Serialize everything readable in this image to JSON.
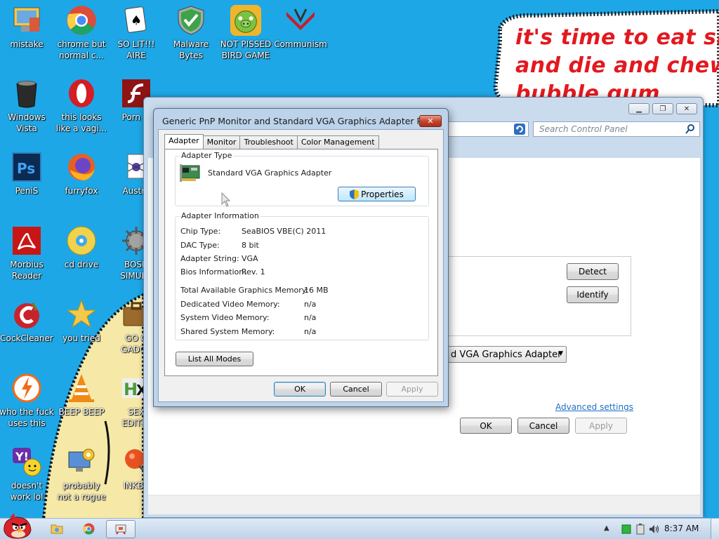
{
  "wallpaper": {
    "speech_lines": [
      "it's time to eat shit",
      "and die and chew",
      "bubble gum"
    ]
  },
  "desktop_icons": [
    {
      "label": "mistake",
      "icon": "computer-icon"
    },
    {
      "label": "chrome but\nnormal c...",
      "icon": "chrome-icon"
    },
    {
      "label": "SO LIT!!!\nAIRE",
      "icon": "solitaire-icon"
    },
    {
      "label": "Malware\nBytes",
      "icon": "shield-check-icon"
    },
    {
      "label": "NOT PISSED\nBIRD GAME",
      "icon": "green-pig-icon"
    },
    {
      "label": "Communism",
      "icon": "communism-icon"
    },
    {
      "label": "Windows\nVista",
      "icon": "recycle-bin-icon"
    },
    {
      "label": "this looks\nlike a vagi...",
      "icon": "opera-icon"
    },
    {
      "label": "Porn Pl",
      "icon": "flash-icon"
    },
    {
      "label": "PeniS",
      "icon": "photoshop-icon"
    },
    {
      "label": "furryfox",
      "icon": "firefox-icon"
    },
    {
      "label": "Austra",
      "icon": "spider-solitaire-icon"
    },
    {
      "label": "Morbius\nReader",
      "icon": "acrobat-icon"
    },
    {
      "label": "cd drive",
      "icon": "cd-icon"
    },
    {
      "label": "BOSN\nSIMULA",
      "icon": "gear-ball-icon"
    },
    {
      "label": "CockCleaner",
      "icon": "ccleaner-icon"
    },
    {
      "label": "you tried",
      "icon": "star-icon"
    },
    {
      "label": "GO G\nGADGE",
      "icon": "briefcase-icon"
    },
    {
      "label": "who the fuck\nuses this",
      "icon": "avast-icon"
    },
    {
      "label": "BEEP BEEP",
      "icon": "vlc-icon"
    },
    {
      "label": "SEX\nEDITIO",
      "icon": "hx-icon"
    },
    {
      "label": "doesn't\nwork lol",
      "icon": "yahoo-icon"
    },
    {
      "label": "probably\nnot a rogue",
      "icon": "gear-monitor-icon"
    },
    {
      "label": "INKBA",
      "icon": "pin-icon"
    }
  ],
  "control_panel": {
    "search_placeholder": "Search Control Panel",
    "detect_label": "Detect",
    "identify_label": "Identify",
    "display_select": "d VGA Graphics Adapter",
    "advanced_link": "Advanced settings",
    "ok_label": "OK",
    "cancel_label": "Cancel",
    "apply_label": "Apply"
  },
  "dialog": {
    "title": "Generic PnP Monitor and Standard VGA Graphics Adapter Pr...",
    "close_glyph": "✕",
    "tabs": [
      "Adapter",
      "Monitor",
      "Troubleshoot",
      "Color Management"
    ],
    "adapter_type_legend": "Adapter Type",
    "adapter_name": "Standard VGA Graphics Adapter",
    "properties_label": "Properties",
    "adapter_info_legend": "Adapter Information",
    "info": [
      {
        "key": "Chip Type:",
        "value": "SeaBIOS VBE(C) 2011"
      },
      {
        "key": "DAC Type:",
        "value": "8 bit"
      },
      {
        "key": "Adapter String:",
        "value": "VGA"
      },
      {
        "key": "Bios Information:",
        "value": "Rev. 1"
      }
    ],
    "memory": [
      {
        "key": "Total Available Graphics Memory:",
        "value": "16 MB"
      },
      {
        "key": "Dedicated Video Memory:",
        "value": "n/a"
      },
      {
        "key": "System Video Memory:",
        "value": "n/a"
      },
      {
        "key": "Shared System Memory:",
        "value": "n/a"
      }
    ],
    "list_modes_label": "List All Modes",
    "ok_label": "OK",
    "cancel_label": "Cancel",
    "apply_label": "Apply"
  },
  "taskbar": {
    "clock": "8:37 AM",
    "tray_icons": [
      "show-hidden-icon",
      "network-icon",
      "battery-icon",
      "volume-icon"
    ],
    "pinned": [
      "angry-bird-start-icon",
      "folder-icon",
      "chrome-icon",
      "display-settings-icon"
    ]
  },
  "colors": {
    "desktop_bg": "#1ea7e6",
    "speech_text": "#e3191f",
    "link": "#1f6fc4"
  }
}
